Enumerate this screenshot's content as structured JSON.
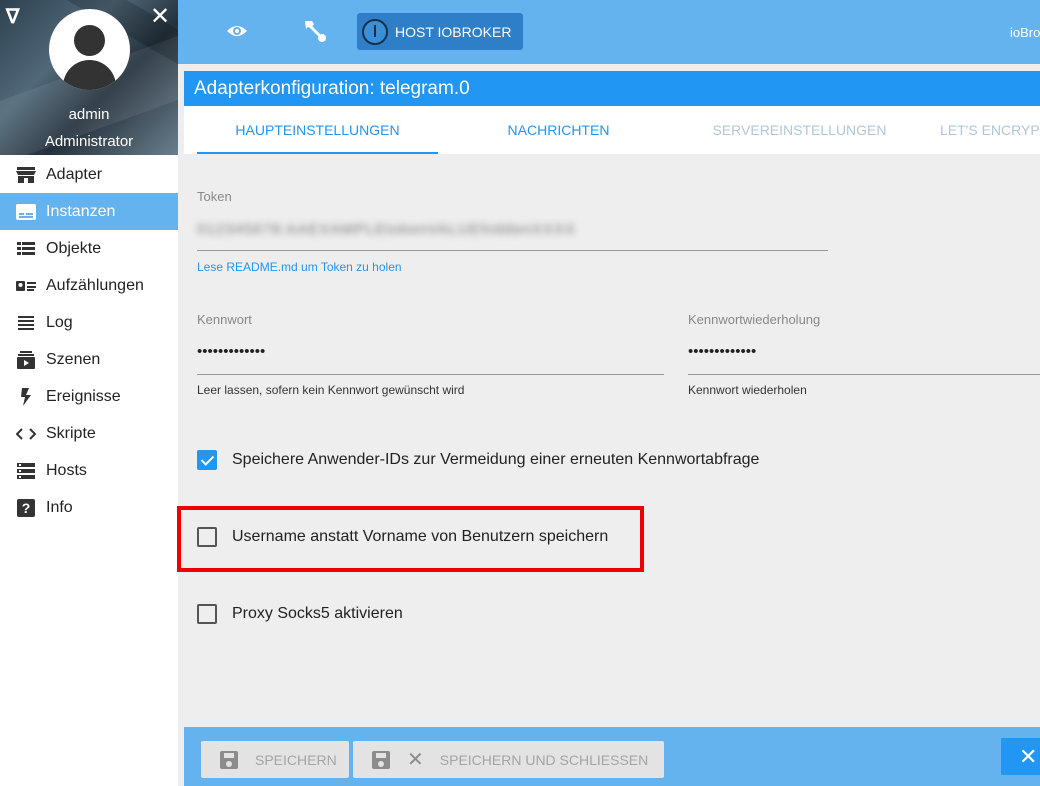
{
  "sidebar": {
    "user_name": "admin",
    "user_role": "Administrator",
    "items": [
      {
        "label": "Adapter",
        "icon": "store-icon",
        "active": false
      },
      {
        "label": "Instanzen",
        "icon": "instances-icon",
        "active": true
      },
      {
        "label": "Objekte",
        "icon": "list-icon",
        "active": false
      },
      {
        "label": "Aufzählungen",
        "icon": "enum-icon",
        "active": false
      },
      {
        "label": "Log",
        "icon": "log-icon",
        "active": false
      },
      {
        "label": "Szenen",
        "icon": "scenes-icon",
        "active": false
      },
      {
        "label": "Ereignisse",
        "icon": "flash-icon",
        "active": false
      },
      {
        "label": "Skripte",
        "icon": "code-icon",
        "active": false
      },
      {
        "label": "Hosts",
        "icon": "hosts-icon",
        "active": false
      },
      {
        "label": "Info",
        "icon": "help-icon",
        "active": false
      }
    ]
  },
  "topbar": {
    "host_button_label": "HOST IOBROKER",
    "right_text": "ioBroker"
  },
  "panel": {
    "title": "Adapterkonfiguration: telegram.0",
    "tabs": [
      {
        "label": "HAUPTEINSTELLUNGEN",
        "state": "active"
      },
      {
        "label": "NACHRICHTEN",
        "state": "normal"
      },
      {
        "label": "SERVEREINSTELLUNGEN",
        "state": "disabled"
      },
      {
        "label": "LET'S ENCRYPT",
        "state": "disabled"
      }
    ]
  },
  "form": {
    "token": {
      "label": "Token",
      "value": "012345678:AAEXAMPLEtokenVALUEhiddenXXXX",
      "help": "Lese README.md um Token zu holen"
    },
    "password": {
      "label": "Kennwort",
      "value": "•••••••••••••",
      "help": "Leer lassen, sofern kein Kennwort gewünscht wird"
    },
    "password_repeat": {
      "label": "Kennwortwiederholung",
      "value": "•••••••••••••",
      "help": "Kennwort wiederholen"
    },
    "checkboxes": [
      {
        "label": "Speichere Anwender-IDs zur Vermeidung einer erneuten Kennwortabfrage",
        "checked": true
      },
      {
        "label": "Username anstatt Vorname von Benutzern speichern",
        "checked": false
      },
      {
        "label": "Proxy Socks5 aktivieren",
        "checked": false
      }
    ]
  },
  "footer": {
    "save_label": "SPEICHERN",
    "save_close_label": "SPEICHERN UND SCHLIESSEN",
    "close_label": "✕"
  },
  "colors": {
    "accent": "#2196f3",
    "topbar": "#64b3ee",
    "highlight": "#ee0000"
  }
}
